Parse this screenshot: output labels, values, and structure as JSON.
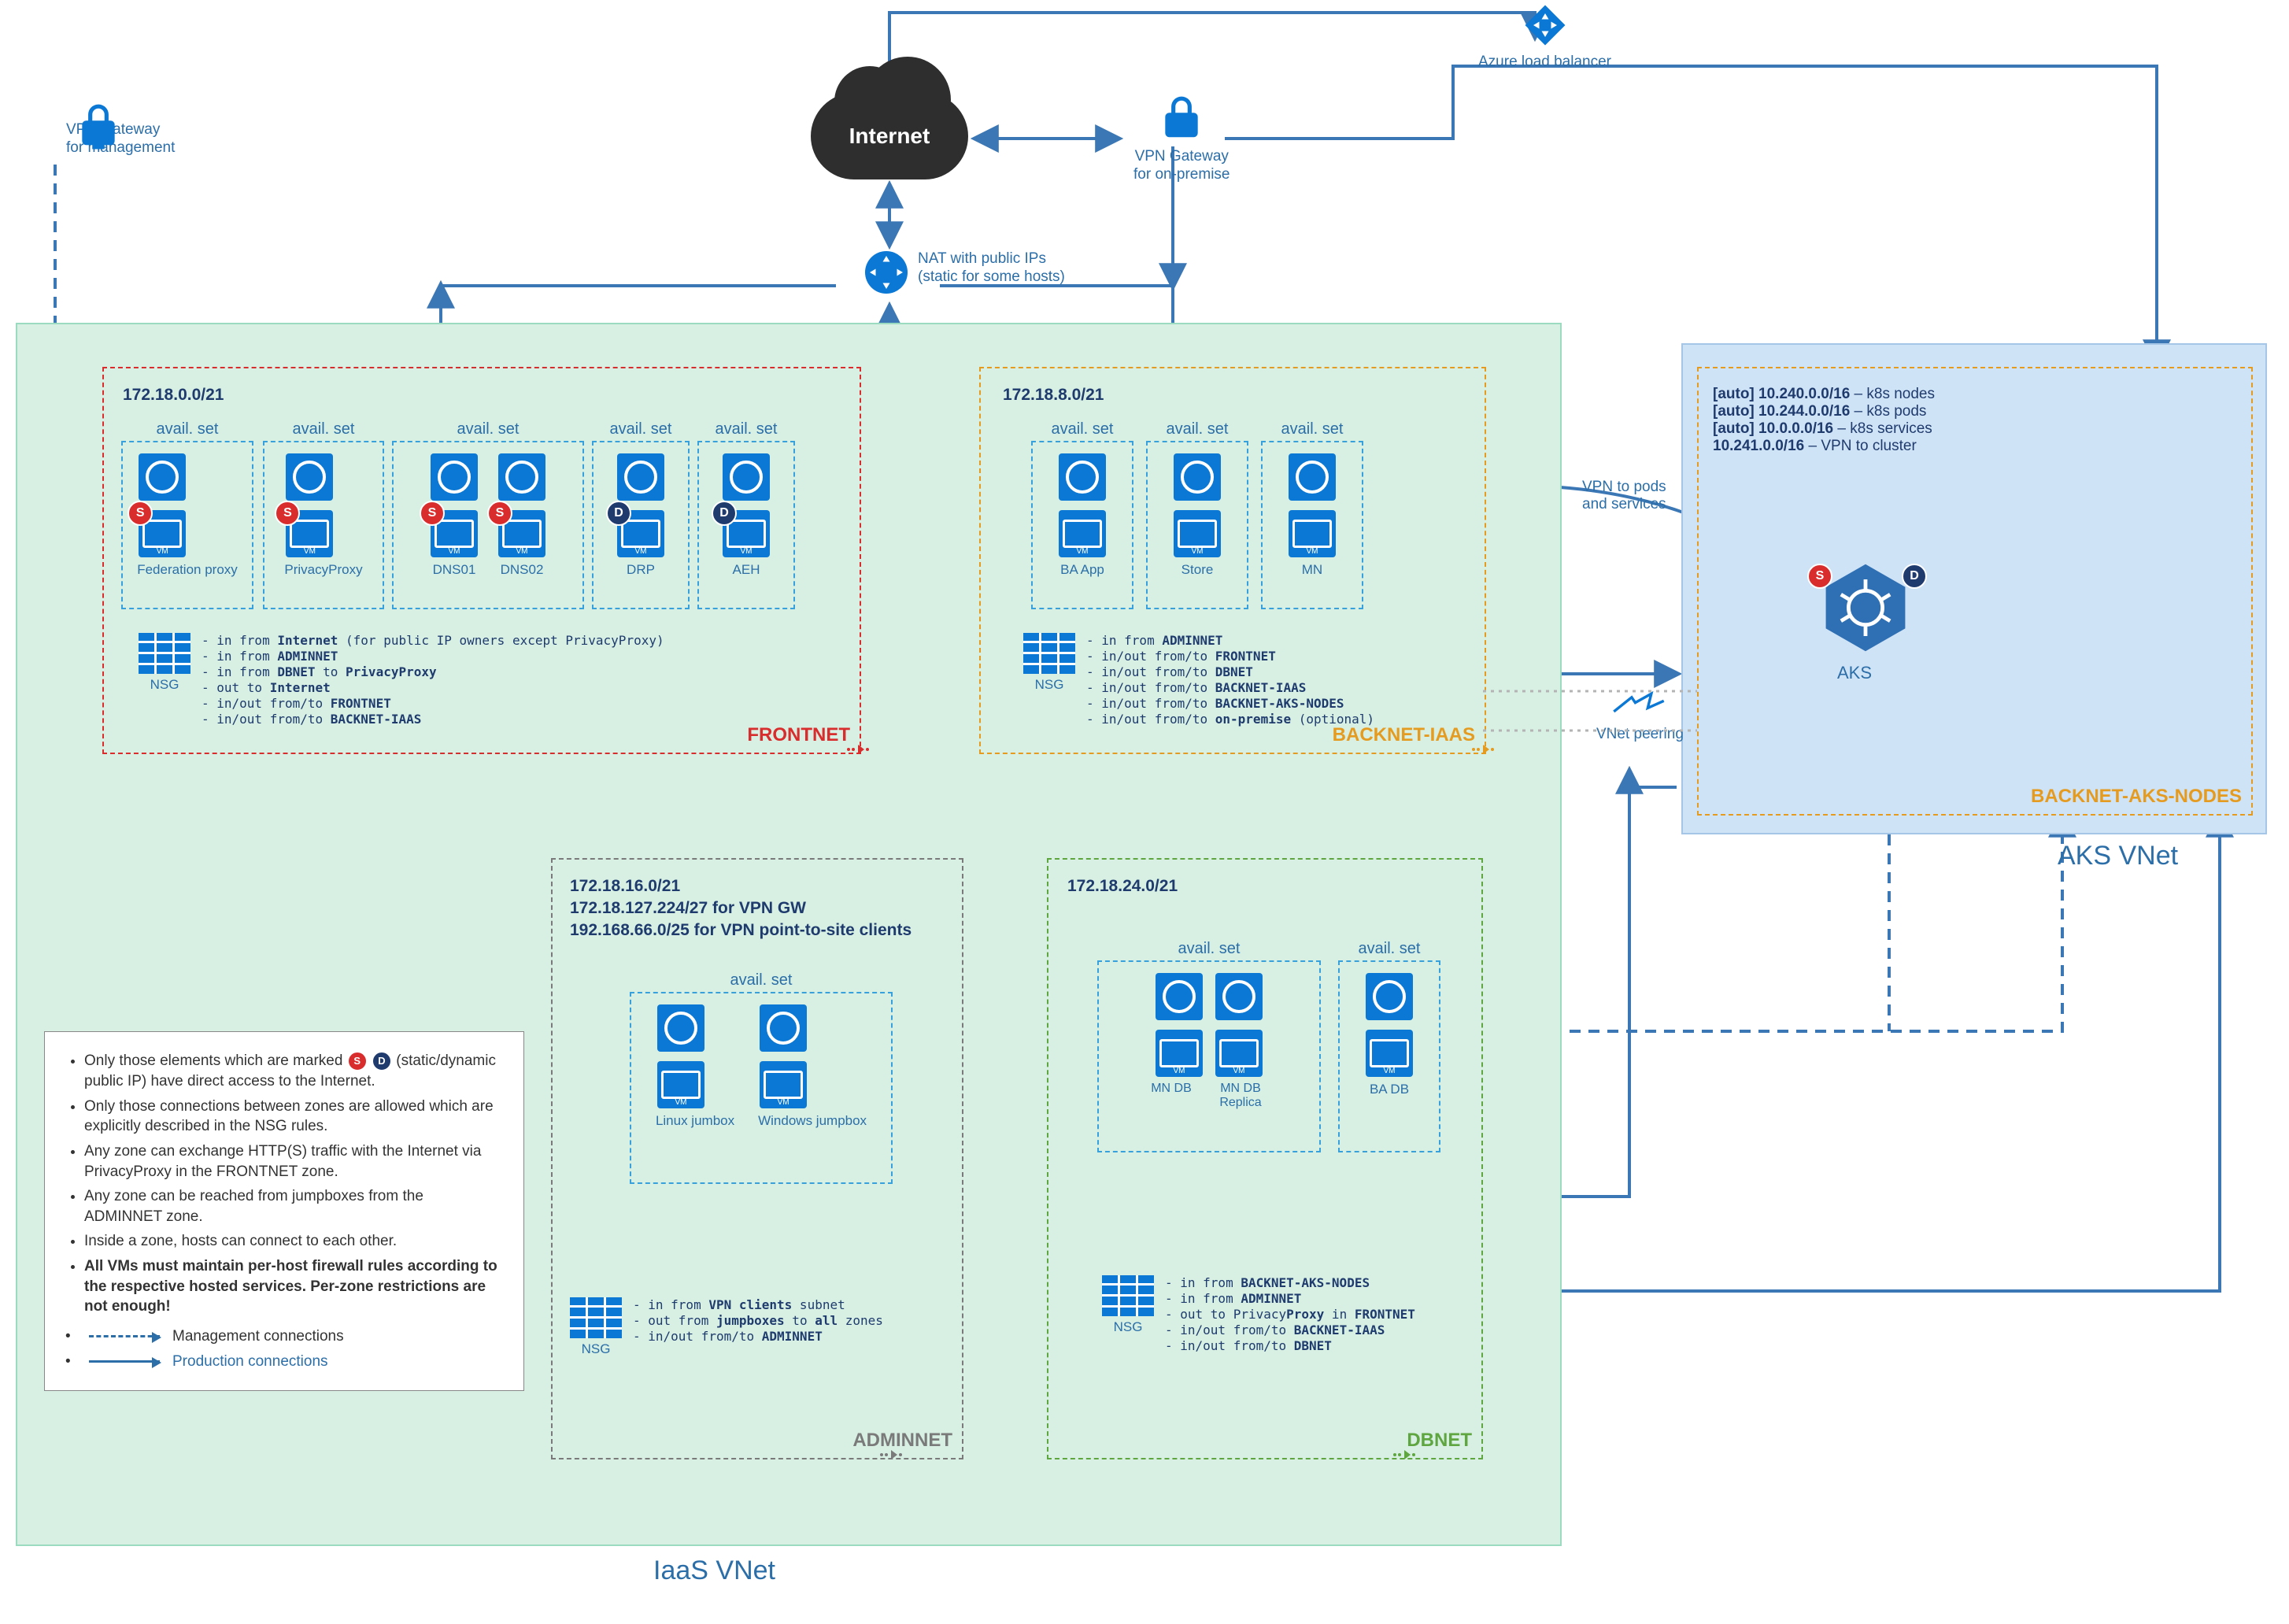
{
  "external": {
    "vpn_mgmt": "VPN Gateway\nfor management",
    "vpn_onprem": "VPN Gateway\nfor on-premise",
    "loadbalancer": "Azure load balancer",
    "nat": "NAT with public IPs\n(static for some hosts)",
    "internet": "Internet",
    "vnet_peering": "VNet peering",
    "vpn_pods": "VPN to pods\nand services"
  },
  "vnets": {
    "iaas": "IaaS VNet",
    "aks": "AKS VNet"
  },
  "frontnet": {
    "name": "FRONTNET",
    "cidr": "172.18.0.0/21",
    "availset": "avail. set",
    "vms": [
      "Federation proxy",
      "PrivacyProxy",
      "DNS01",
      "DNS02",
      "DRP",
      "AEH"
    ],
    "badges": [
      "S",
      "S",
      "S",
      "S",
      "D",
      "D"
    ],
    "nsg": "NSG",
    "rules": [
      "- in from <b>Internet</b> (for public IP owners except PrivacyProxy)",
      "- in from <b>ADMINNET</b>",
      "- in from <b>DBNET</b> to <b>PrivacyProxy</b>",
      "- out to <b>Internet</b>",
      "- in/out from/to <b>FRONTNET</b>",
      "- in/out from/to <b>BACKNET-IAAS</b>"
    ]
  },
  "backnet_iaas": {
    "name": "BACKNET-IAAS",
    "cidr": "172.18.8.0/21",
    "availset": "avail. set",
    "vms": [
      "BA App",
      "Store",
      "MN"
    ],
    "nsg": "NSG",
    "rules": [
      "- in from <b>ADMINNET</b>",
      "- in/out from/to <b>FRONTNET</b>",
      "- in/out from/to <b>DBNET</b>",
      "- in/out from/to <b>BACKNET-IAAS</b>",
      "- in/out from/to <b>BACKNET-AKS-NODES</b>",
      "- in/out from/to <b>on-premise</b> (optional)"
    ]
  },
  "adminnet": {
    "name": "ADMINNET",
    "cidr1": "172.18.16.0/21",
    "cidr2": "172.18.127.224/27 for VPN GW",
    "cidr3": "192.168.66.0/25 for VPN point-to-site clients",
    "availset": "avail. set",
    "vms": [
      "Linux jumbox",
      "Windows jumpbox"
    ],
    "nsg": "NSG",
    "rules": [
      "- in from <b>VPN clients</b> subnet",
      "- out from <b>jumpboxes</b> to <b>all</b> zones",
      "- in/out from/to <b>ADMINNET</b>"
    ]
  },
  "dbnet": {
    "name": "DBNET",
    "cidr": "172.18.24.0/21",
    "availset": "avail. set",
    "vms": [
      "MN DB",
      "MN DB Replica",
      "BA DB"
    ],
    "nsg": "NSG",
    "rules": [
      "- in from <b>BACKNET-AKS-NODES</b>",
      "- in from <b>ADMINNET</b>",
      "- out to Privacy<b>Proxy</b> in <b>FRONTNET</b>",
      "- in/out from/to <b>BACKNET-IAAS</b>",
      "- in/out from/to <b>DBNET</b>"
    ]
  },
  "backnet_aks": {
    "name": "BACKNET-AKS-NODES",
    "cidrs": [
      {
        "b": "[auto] 10.240.0.0/16",
        "t": " – k8s nodes"
      },
      {
        "b": "[auto] 10.244.0.0/16",
        "t": " – k8s pods"
      },
      {
        "b": "[auto] 10.0.0.0/16",
        "t": " – k8s services"
      },
      {
        "b": "10.241.0.0/16",
        "t": " – VPN to cluster"
      }
    ],
    "aks": "AKS",
    "badges": [
      "S",
      "D"
    ]
  },
  "legend": {
    "bullets": [
      "Only those elements which are marked <span class='badge badge-s' style='position:static;display:inline-flex;width:22px;height:22px;font-size:13px;vertical-align:middle'>S</span> <span class='badge badge-d' style='position:static;display:inline-flex;width:22px;height:22px;font-size:13px;vertical-align:middle'>D</span> (static/dynamic public IP) have direct access to the Internet.",
      "Only those connections between zones are allowed which are explicitly described in the NSG rules.",
      "Any zone can exchange HTTP(S) traffic with the Internet via PrivacyProxy in the FRONTNET zone.",
      "Any zone can be reached from jumpboxes from the ADMINNET zone.",
      "Inside a zone, hosts can connect to each other.",
      "<b>All VMs must maintain per-host firewall rules according to the respective hosted services. Per-zone restrictions are not enough!</b>"
    ],
    "mgmt": "Management connections",
    "prod": "Production connections"
  }
}
